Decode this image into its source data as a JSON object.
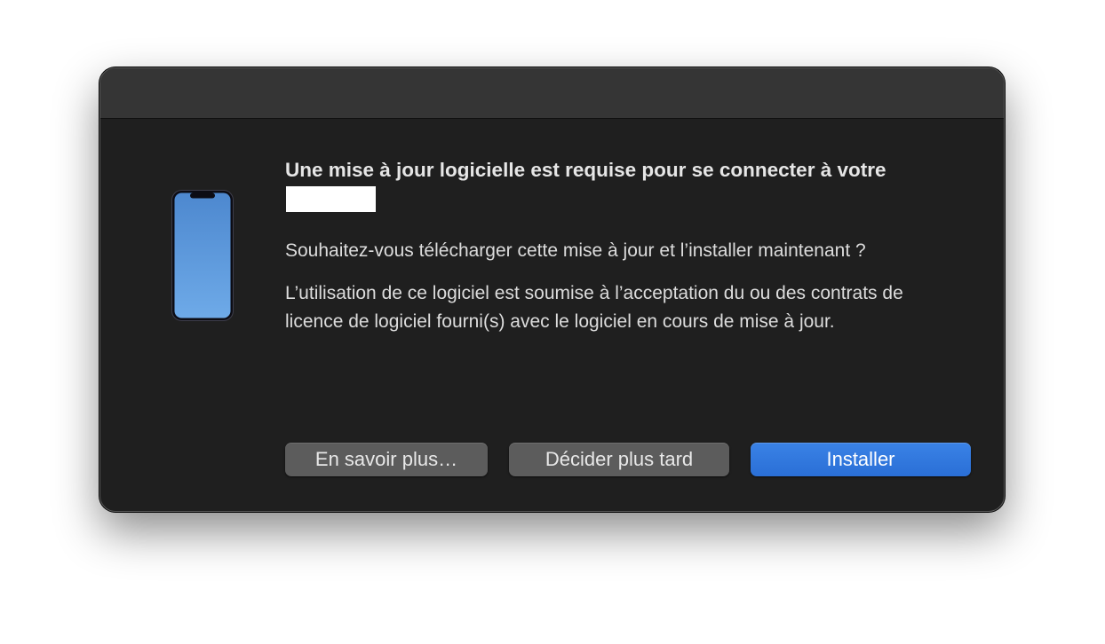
{
  "dialog": {
    "headline": "Une mise à jour logicielle est requise pour se connecter à votre",
    "question": "Souhaitez-vous télécharger cette mise à jour et l’installer maintenant ?",
    "license_text": "L’utilisation de ce logiciel est soumise à l’acceptation du ou des contrats de licence de logiciel fourni(s) avec le logiciel en cours de mise à jour.",
    "icon": "iphone-icon"
  },
  "buttons": {
    "learn_more": "En savoir plus…",
    "decide_later": "Décider plus tard",
    "install": "Installer"
  },
  "colors": {
    "accent": "#2f74dc",
    "dialog_background": "#1f1f1f",
    "titlebar": "#353535",
    "secondary_button": "#5c5c5c"
  }
}
